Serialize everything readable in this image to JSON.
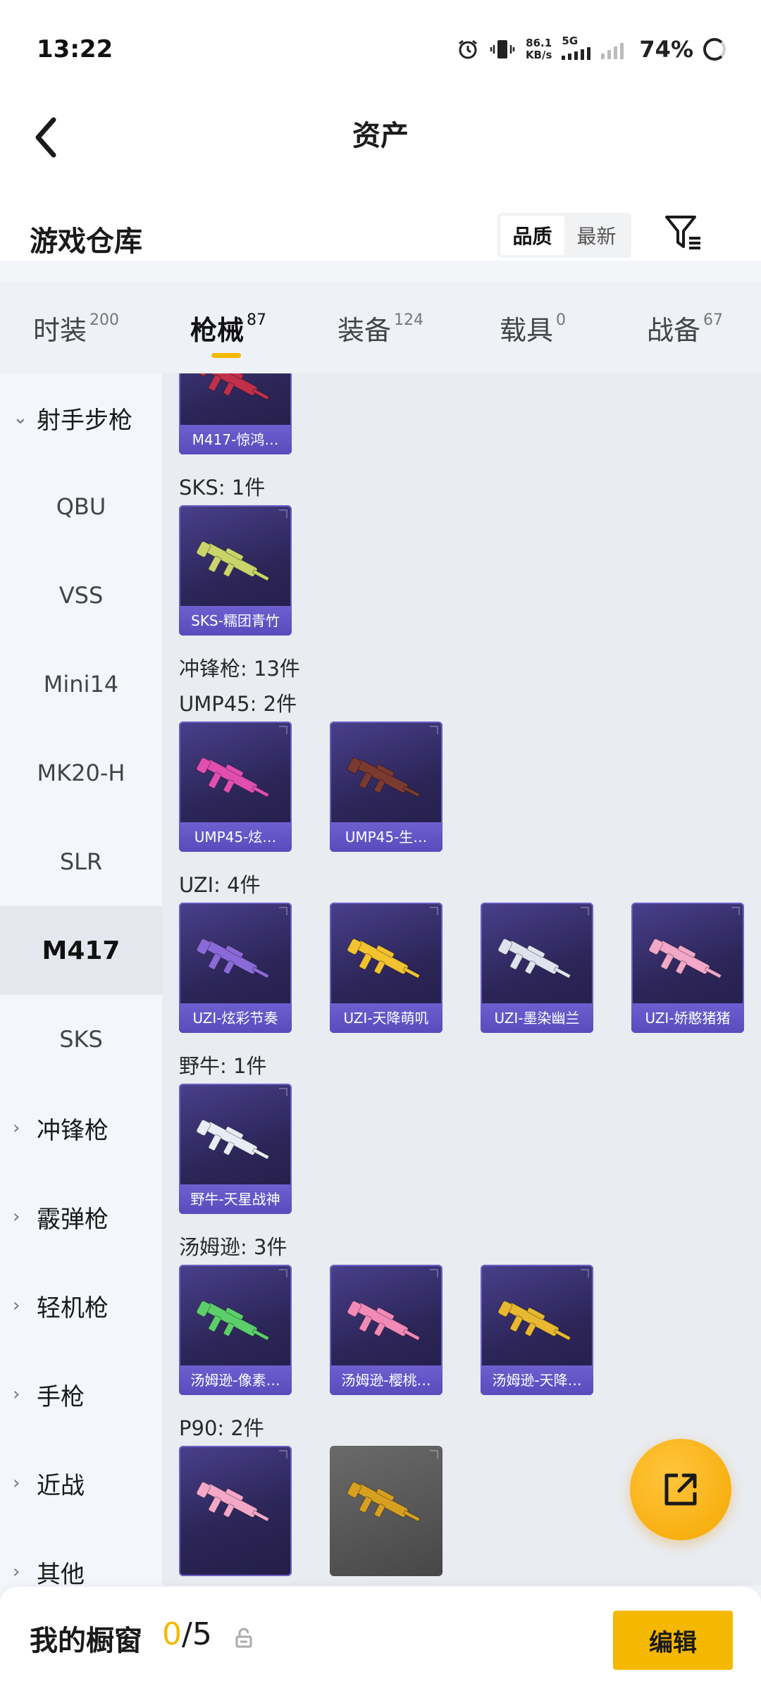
{
  "status_bar": {
    "time": "13:22",
    "net_speed_value": "86.1",
    "net_speed_unit": "KB/s",
    "network_type": "5G",
    "battery": "74%"
  },
  "header": {
    "title": "资产",
    "section_title": "游戏仓库",
    "sort_options": [
      "品质",
      "最新"
    ],
    "sort_selected": "品质"
  },
  "tabs": [
    {
      "label": "时装",
      "count": "200",
      "active": false
    },
    {
      "label": "枪械",
      "count": "87",
      "active": true
    },
    {
      "label": "装备",
      "count": "124",
      "active": false
    },
    {
      "label": "载具",
      "count": "0",
      "active": false
    },
    {
      "label": "战备",
      "count": "67",
      "active": false
    }
  ],
  "sidebar": {
    "items": [
      {
        "label": "射手步枪",
        "type": "group",
        "expanded": true,
        "chevron": "⌄"
      },
      {
        "label": "QBU",
        "type": "sub"
      },
      {
        "label": "VSS",
        "type": "sub"
      },
      {
        "label": "Mini14",
        "type": "sub"
      },
      {
        "label": "MK20-H",
        "type": "sub"
      },
      {
        "label": "SLR",
        "type": "sub"
      },
      {
        "label": "M417",
        "type": "sub",
        "active": true
      },
      {
        "label": "SKS",
        "type": "sub"
      },
      {
        "label": "冲锋枪",
        "type": "group",
        "chevron": "›"
      },
      {
        "label": "霰弹枪",
        "type": "group",
        "chevron": "›"
      },
      {
        "label": "轻机枪",
        "type": "group",
        "chevron": "›"
      },
      {
        "label": "手枪",
        "type": "group",
        "chevron": "›"
      },
      {
        "label": "近战",
        "type": "group",
        "chevron": "›"
      },
      {
        "label": "其他",
        "type": "group",
        "chevron": "›"
      }
    ]
  },
  "content": {
    "sections": [
      {
        "heading": "",
        "items": [
          {
            "name": "M417-惊鸿…",
            "color": "#c0304a"
          }
        ]
      },
      {
        "heading": "SKS: 1件",
        "items": [
          {
            "name": "SKS-糯团青竹",
            "color": "#c9d46a"
          }
        ]
      },
      {
        "heading": "冲锋枪: 13件",
        "items": []
      },
      {
        "heading": "UMP45: 2件",
        "items": [
          {
            "name": "UMP45-炫…",
            "color": "#e04fb0"
          },
          {
            "name": "UMP45-生…",
            "color": "#7a3a30"
          }
        ]
      },
      {
        "heading": "UZI: 4件",
        "items": [
          {
            "name": "UZI-炫彩节奏",
            "color": "#8a6ad8"
          },
          {
            "name": "UZI-天降萌叽",
            "color": "#f2c230"
          },
          {
            "name": "UZI-墨染幽兰",
            "color": "#dfe3ee"
          },
          {
            "name": "UZI-娇憨猪猪",
            "color": "#f2a8c8"
          }
        ]
      },
      {
        "heading": "野牛: 1件",
        "items": [
          {
            "name": "野牛-天星战神",
            "color": "#e8ecf5"
          }
        ]
      },
      {
        "heading": "汤姆逊: 3件",
        "items": [
          {
            "name": "汤姆逊-像素…",
            "color": "#5ccf6a"
          },
          {
            "name": "汤姆逊-樱桃…",
            "color": "#f28ab8"
          },
          {
            "name": "汤姆逊-天降…",
            "color": "#e8b830"
          }
        ]
      },
      {
        "heading": "P90: 2件",
        "items": [
          {
            "name": "",
            "color": "#f4a8c8"
          },
          {
            "name": "",
            "color": "#d8a020",
            "gray": true
          }
        ]
      }
    ]
  },
  "bottom_bar": {
    "label": "我的橱窗",
    "current": "0",
    "separator": "/",
    "max": "5",
    "edit_label": "编辑"
  },
  "colors": {
    "accent": "#f5b800",
    "card_bg": "#2c2557",
    "card_label": "#5a4bbd"
  }
}
